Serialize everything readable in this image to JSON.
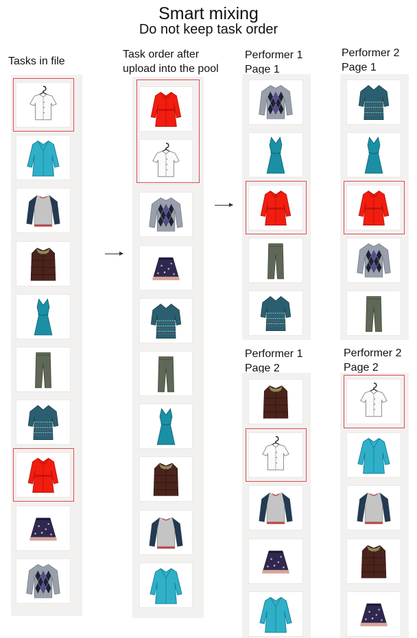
{
  "title": "Smart mixing",
  "subtitle": "Do not keep task order",
  "labels": {
    "tasks_in_file": "Tasks in file",
    "pool_order": "Task order after\nupload into the pool",
    "p1_page1": "Performer 1\nPage 1",
    "p2_page1": "Performer 2\nPage 1",
    "p1_page2": "Performer 1\nPage 2",
    "p2_page2": "Performer 2\nPage 2"
  },
  "colors": {
    "highlight": "#e0484b",
    "column_background": "#f2f1ef"
  },
  "columns": {
    "tasks_in_file": [
      "white-shirt",
      "teal-coat",
      "raglan-sweater",
      "puffer-vest",
      "teal-dress",
      "gray-pants",
      "patterned-tunic",
      "red-coat",
      "floral-skirt",
      "argyle-sweater"
    ],
    "pool_order": [
      "red-coat",
      "white-shirt",
      "argyle-sweater",
      "floral-skirt",
      "patterned-tunic",
      "gray-pants",
      "teal-dress",
      "puffer-vest",
      "raglan-sweater",
      "teal-coat"
    ],
    "p1_page1": [
      "argyle-sweater",
      "teal-dress",
      "red-coat",
      "gray-pants",
      "patterned-tunic"
    ],
    "p2_page1": [
      "patterned-tunic",
      "teal-dress",
      "red-coat",
      "argyle-sweater",
      "gray-pants"
    ],
    "p1_page2": [
      "puffer-vest",
      "white-shirt",
      "raglan-sweater",
      "floral-skirt",
      "teal-coat"
    ],
    "p2_page2": [
      "white-shirt",
      "teal-coat",
      "raglan-sweater",
      "puffer-vest",
      "floral-skirt"
    ]
  },
  "highlighted": {
    "tasks_in_file": [
      "white-shirt",
      "red-coat"
    ],
    "pool_order": [
      "red-coat",
      "white-shirt"
    ],
    "p1_page1": [
      "red-coat"
    ],
    "p2_page1": [
      "red-coat"
    ],
    "p1_page2": [
      "white-shirt"
    ],
    "p2_page2": [
      "white-shirt"
    ]
  },
  "icon_names": [
    "white-shirt-icon",
    "teal-coat-icon",
    "raglan-sweater-icon",
    "puffer-vest-icon",
    "teal-dress-icon",
    "gray-pants-icon",
    "patterned-tunic-icon",
    "red-coat-icon",
    "floral-skirt-icon",
    "argyle-sweater-icon"
  ]
}
